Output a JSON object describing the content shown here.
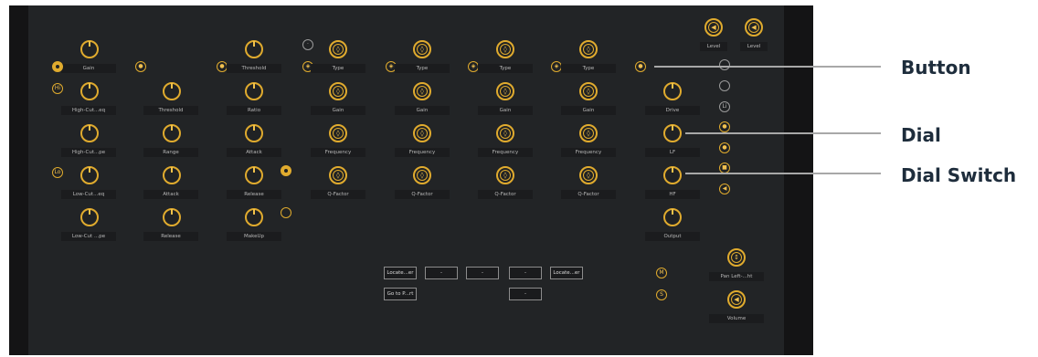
{
  "knob_labels": {
    "gain": "Gain",
    "high_cut_eq": "High-Cut...eq",
    "high_cut_pe": "High-Cut...pe",
    "low_cut_eq": "Low-Cut...eq",
    "low_cut_pe": "Low-Cut ...pe",
    "threshold_a": "Threshold",
    "range": "Range",
    "attack_a": "Attack",
    "release_a": "Release",
    "threshold_b": "Threshold",
    "ratio": "Ratio",
    "attack_b": "Attack",
    "release_b": "Release",
    "makeup": "MakeUp",
    "drive": "Drive",
    "lf": "LF",
    "hf": "HF",
    "output": "Output",
    "level1": "Level",
    "level2": "Level",
    "pan": "Pan Left-...ht",
    "volume": "Volume"
  },
  "eq_bands": [
    {
      "type": "Type",
      "gain": "Gain",
      "freq": "Frequency",
      "q": "Q-Factor"
    },
    {
      "type": "Type",
      "gain": "Gain",
      "freq": "Frequency",
      "q": "Q-Factor"
    },
    {
      "type": "Type",
      "gain": "Gain",
      "freq": "Frequency",
      "q": "Q-Factor"
    },
    {
      "type": "Type",
      "gain": "Gain",
      "freq": "Frequency",
      "q": "Q-Factor"
    }
  ],
  "side_buttons": {
    "hi": "Hi",
    "lo": "Lo",
    "li": "Li",
    "m": "M",
    "s": "S"
  },
  "transport": {
    "locate_left": "Locate...er",
    "dash1": "-",
    "dash2": "-",
    "dash3": "-",
    "locate_right": "Locate...er",
    "goto": "Go to P...rt",
    "dash4": "-"
  },
  "callouts": {
    "button": "Button",
    "dial": "Dial",
    "dial_switch": "Dial Switch"
  },
  "colors": {
    "accent": "#e0ab2e",
    "panel": "#222426",
    "frame": "#141415"
  }
}
